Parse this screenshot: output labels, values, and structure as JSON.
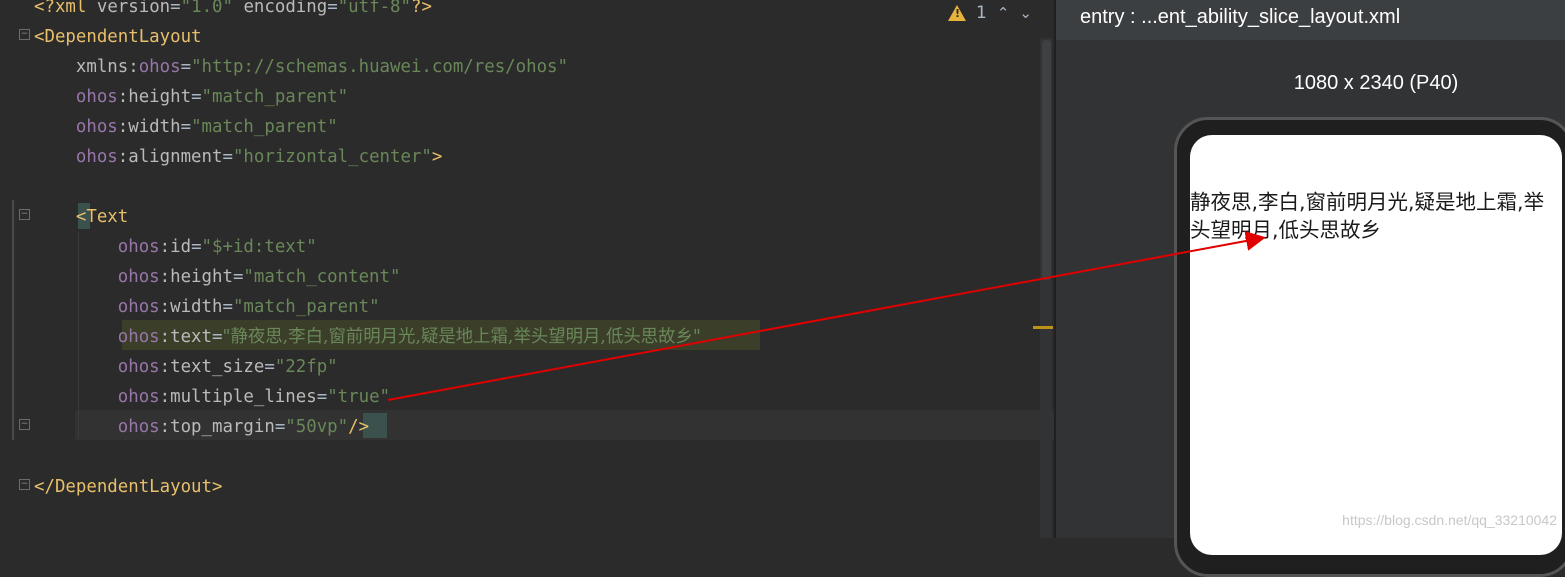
{
  "editor": {
    "lines": [
      [
        {
          "c": "t-punc",
          "t": "<?"
        },
        {
          "c": "t-decl",
          "t": "xml "
        },
        {
          "c": "t-xmlkw",
          "t": "version"
        },
        {
          "c": "t-eq",
          "t": "="
        },
        {
          "c": "t-val",
          "t": "\"1.0\""
        },
        {
          "c": "t-xmlkw",
          "t": " encoding"
        },
        {
          "c": "t-eq",
          "t": "="
        },
        {
          "c": "t-val",
          "t": "\"utf-8\""
        },
        {
          "c": "t-punc",
          "t": "?>"
        }
      ],
      [
        {
          "c": "t-tag",
          "t": "<DependentLayout"
        }
      ],
      [
        {
          "c": "t-attr",
          "t": "    xmlns:"
        },
        {
          "c": "t-ns",
          "t": "ohos"
        },
        {
          "c": "t-eq",
          "t": "="
        },
        {
          "c": "t-val",
          "t": "\"http://schemas.huawei.com/res/ohos\""
        }
      ],
      [
        {
          "c": "t-ns",
          "t": "    ohos"
        },
        {
          "c": "t-attr",
          "t": ":height"
        },
        {
          "c": "t-eq",
          "t": "="
        },
        {
          "c": "t-val",
          "t": "\"match_parent\""
        }
      ],
      [
        {
          "c": "t-ns",
          "t": "    ohos"
        },
        {
          "c": "t-attr",
          "t": ":width"
        },
        {
          "c": "t-eq",
          "t": "="
        },
        {
          "c": "t-val",
          "t": "\"match_parent\""
        }
      ],
      [
        {
          "c": "t-ns",
          "t": "    ohos"
        },
        {
          "c": "t-attr",
          "t": ":alignment"
        },
        {
          "c": "t-eq",
          "t": "="
        },
        {
          "c": "t-val",
          "t": "\"horizontal_center\""
        },
        {
          "c": "t-tag",
          "t": ">"
        }
      ],
      [],
      [
        {
          "c": "t-tag",
          "t": "    <Text"
        }
      ],
      [
        {
          "c": "t-ns",
          "t": "        ohos"
        },
        {
          "c": "t-attr",
          "t": ":id"
        },
        {
          "c": "t-eq",
          "t": "="
        },
        {
          "c": "t-val",
          "t": "\"$+id:text\""
        }
      ],
      [
        {
          "c": "t-ns",
          "t": "        ohos"
        },
        {
          "c": "t-attr",
          "t": ":height"
        },
        {
          "c": "t-eq",
          "t": "="
        },
        {
          "c": "t-val",
          "t": "\"match_content\""
        }
      ],
      [
        {
          "c": "t-ns",
          "t": "        ohos"
        },
        {
          "c": "t-attr",
          "t": ":width"
        },
        {
          "c": "t-eq",
          "t": "="
        },
        {
          "c": "t-val",
          "t": "\"match_parent\""
        }
      ],
      [
        {
          "c": "t-ns",
          "t": "        ohos"
        },
        {
          "c": "t-attr",
          "t": ":text"
        },
        {
          "c": "t-eq",
          "t": "="
        },
        {
          "c": "t-valdim",
          "t": "\"静夜思,李白,窗前明月光,疑是地上霜,举头望明月,低头思故乡\""
        }
      ],
      [
        {
          "c": "t-ns",
          "t": "        ohos"
        },
        {
          "c": "t-attr",
          "t": ":text_size"
        },
        {
          "c": "t-eq",
          "t": "="
        },
        {
          "c": "t-val",
          "t": "\"22fp\""
        }
      ],
      [
        {
          "c": "t-ns",
          "t": "        ohos"
        },
        {
          "c": "t-attr",
          "t": ":multiple_lines"
        },
        {
          "c": "t-eq",
          "t": "="
        },
        {
          "c": "t-val",
          "t": "\"true\""
        }
      ],
      [
        {
          "c": "t-ns",
          "t": "        ohos"
        },
        {
          "c": "t-attr",
          "t": ":top_margin"
        },
        {
          "c": "t-eq",
          "t": "="
        },
        {
          "c": "t-val",
          "t": "\"50vp\""
        },
        {
          "c": "t-tag",
          "t": "/>"
        }
      ],
      [],
      [
        {
          "c": "t-tag",
          "t": "</DependentLayout>"
        }
      ]
    ],
    "inspection_count": "1",
    "nav_up": "⌃",
    "nav_down": "⌄"
  },
  "preview": {
    "title": "entry : ...ent_ability_slice_layout.xml",
    "device": "1080 x 2340 (P40)",
    "rendered_text": "静夜思,李白,窗前明月光,疑是地上霜,举头望明月,低头思故乡"
  },
  "watermark": "https://blog.csdn.net/qq_33210042",
  "colors": {
    "annotation_arrow": "#e00000",
    "warning": "#e8b33a"
  }
}
